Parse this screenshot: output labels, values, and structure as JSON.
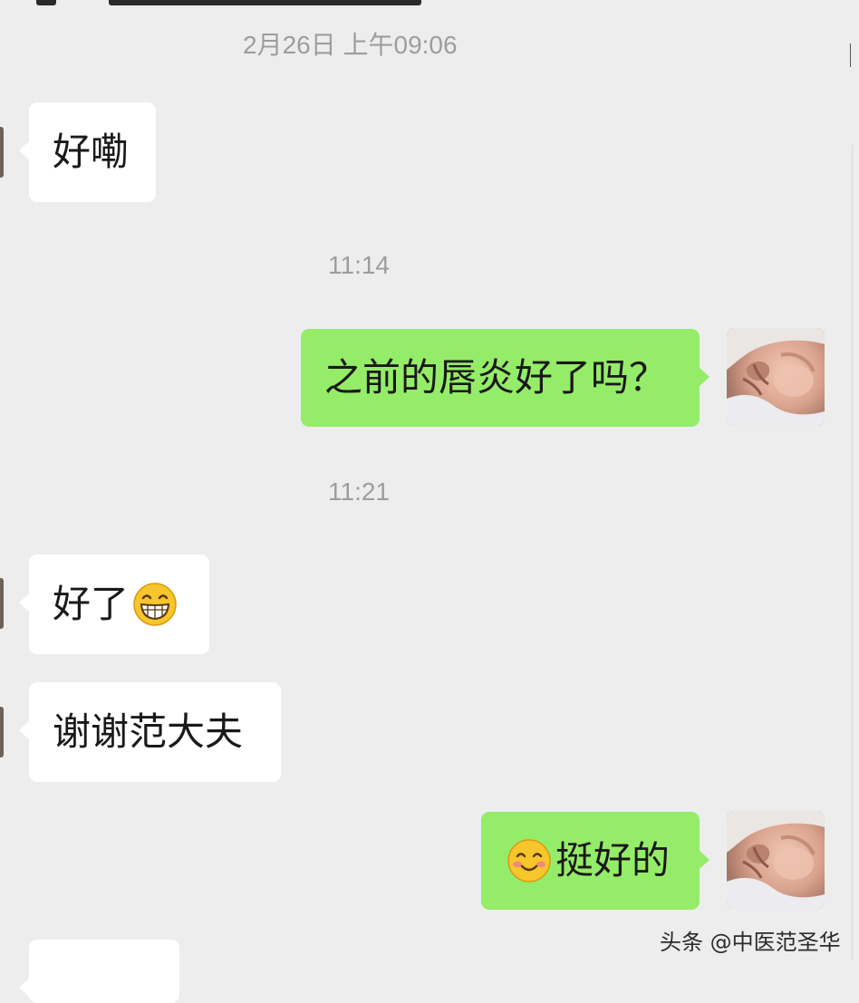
{
  "chat": {
    "timestamps": [
      "2月26日 上午09:06",
      "11:14",
      "11:21"
    ],
    "messages": [
      {
        "side": "received",
        "text": "好嘞"
      },
      {
        "side": "sent",
        "text": "之前的唇炎好了吗？"
      },
      {
        "side": "received",
        "text": "好了",
        "emoji": "grinning-face-icon"
      },
      {
        "side": "received",
        "text": "谢谢范大夫"
      },
      {
        "side": "sent",
        "text": "挺好的",
        "emoji": "smiling-face-icon"
      },
      {
        "side": "received",
        "text": ""
      }
    ]
  },
  "watermark": "头条 @中医范圣华",
  "colors": {
    "background": "#ededed",
    "received_bubble": "#ffffff",
    "sent_bubble": "#95ec69",
    "timestamp": "#9d9d9d"
  }
}
